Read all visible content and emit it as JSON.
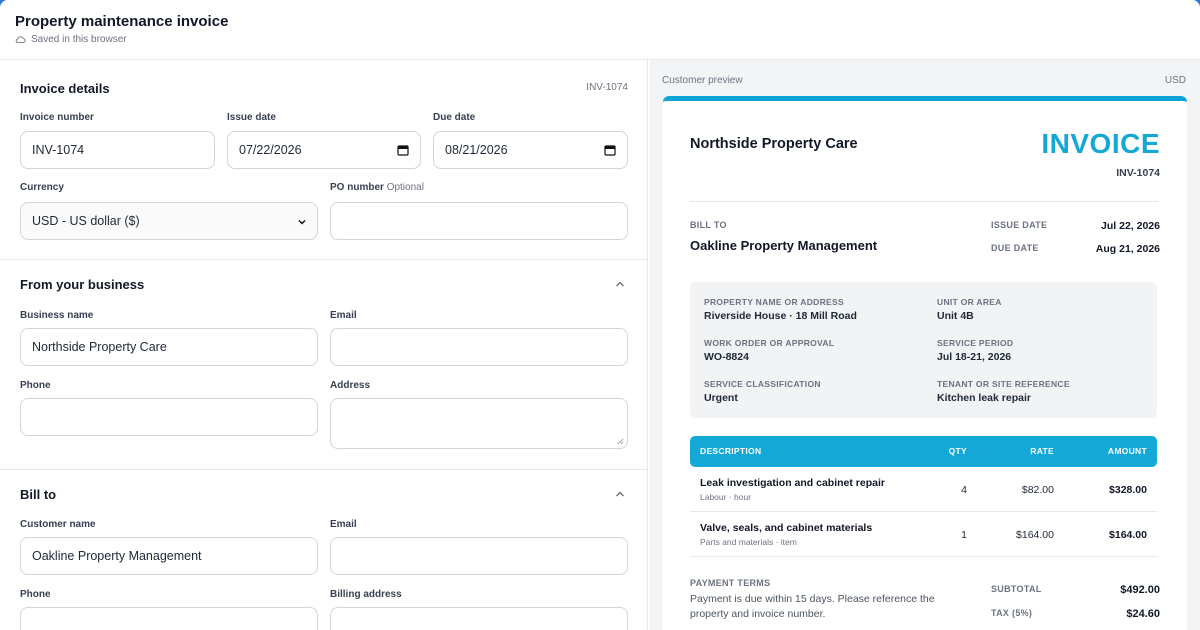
{
  "app": {
    "title": "Property maintenance invoice",
    "saved_status": "Saved in this browser"
  },
  "form": {
    "invoice_details": {
      "title": "Invoice details",
      "badge": "INV-1074",
      "invoice_number_label": "Invoice number",
      "invoice_number_value": "INV-1074",
      "issue_date_label": "Issue date",
      "issue_date_value": "07/22/2026",
      "due_date_label": "Due date",
      "due_date_value": "08/21/2026",
      "currency_label": "Currency",
      "currency_value": "USD - US dollar ($)",
      "po_label": "PO number",
      "po_optional": "Optional",
      "po_value": ""
    },
    "from_business": {
      "title": "From your business",
      "business_name_label": "Business name",
      "business_name_value": "Northside Property Care",
      "email_label": "Email",
      "email_value": "",
      "phone_label": "Phone",
      "phone_value": "",
      "address_label": "Address",
      "address_value": ""
    },
    "bill_to": {
      "title": "Bill to",
      "customer_name_label": "Customer name",
      "customer_name_value": "Oakline Property Management",
      "email_label": "Email",
      "email_value": "",
      "phone_label": "Phone",
      "phone_value": "",
      "billing_address_label": "Billing address",
      "billing_address_value": ""
    }
  },
  "preview": {
    "label": "Customer preview",
    "currency": "USD",
    "company": "Northside Property Care",
    "invoice_word": "INVOICE",
    "invoice_number": "INV-1074",
    "bill_to_caption": "BILL TO",
    "bill_to_name": "Oakline Property Management",
    "issue_date_caption": "ISSUE DATE",
    "issue_date": "Jul 22, 2026",
    "due_date_caption": "DUE DATE",
    "due_date": "Aug 21, 2026",
    "details": {
      "property_caption": "PROPERTY NAME OR ADDRESS",
      "property": "Riverside House · 18 Mill Road",
      "unit_caption": "UNIT OR AREA",
      "unit": "Unit 4B",
      "work_order_caption": "WORK ORDER OR APPROVAL",
      "work_order": "WO-8824",
      "service_period_caption": "SERVICE PERIOD",
      "service_period": "Jul 18-21, 2026",
      "classification_caption": "SERVICE CLASSIFICATION",
      "classification": "Urgent",
      "tenant_caption": "TENANT OR SITE REFERENCE",
      "tenant": "Kitchen leak repair"
    },
    "table": {
      "headers": {
        "description": "DESCRIPTION",
        "qty": "QTY",
        "rate": "RATE",
        "amount": "AMOUNT"
      },
      "rows": [
        {
          "description": "Leak investigation and cabinet repair",
          "sub": "Labour · hour",
          "qty": "4",
          "rate": "$82.00",
          "amount": "$328.00"
        },
        {
          "description": "Valve, seals, and cabinet materials",
          "sub": "Parts and materials · item",
          "qty": "1",
          "rate": "$164.00",
          "amount": "$164.00"
        }
      ]
    },
    "payment_terms_caption": "PAYMENT TERMS",
    "payment_terms": "Payment is due within 15 days. Please reference the property and invoice number.",
    "subtotal_caption": "SUBTOTAL",
    "subtotal": "$492.00",
    "tax_caption": "TAX (5%)",
    "tax": "$24.60"
  },
  "icons": {
    "cloud": "cloud-icon",
    "calendar": "calendar-icon",
    "chevron_up": "chevron-up-icon",
    "chevron_down": "chevron-down-icon"
  },
  "colors": {
    "accent": "#14a8d6",
    "frame": "#2f7bd6"
  }
}
